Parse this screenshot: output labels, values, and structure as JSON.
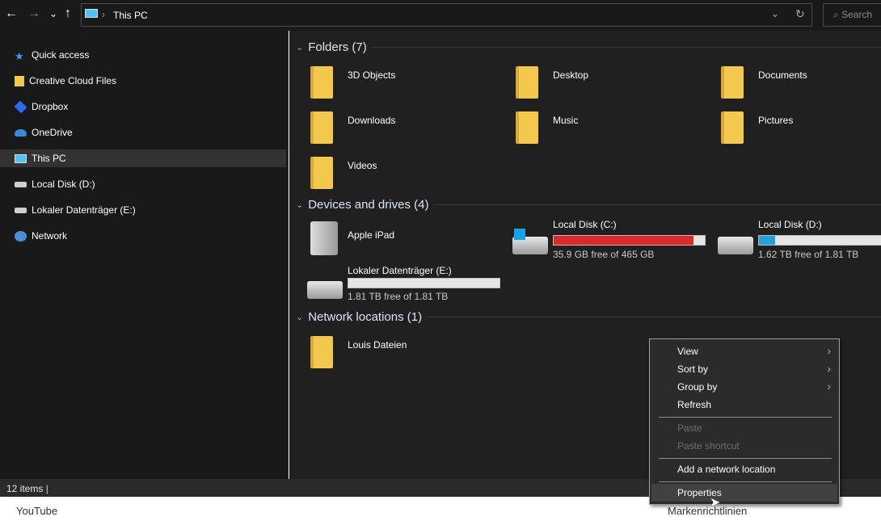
{
  "nav": {
    "back": "←",
    "forward": "→",
    "recent": "⌄",
    "up": "↑",
    "refresh": "↻",
    "dropdown": "⌄"
  },
  "address": {
    "path": "This PC",
    "separator": "›"
  },
  "search": {
    "placeholder": "Search"
  },
  "sidebar": {
    "items": [
      {
        "label": "Quick access",
        "icon": "star-icon",
        "color": "#3aa0ff"
      },
      {
        "label": "Creative Cloud Files",
        "icon": "creative-cloud-icon",
        "color": "#f2c94c"
      },
      {
        "label": "Dropbox",
        "icon": "dropbox-icon",
        "color": "#2a6bf2"
      },
      {
        "label": "OneDrive",
        "icon": "onedrive-icon",
        "color": "#2f8ee0"
      },
      {
        "label": "This PC",
        "icon": "computer-icon",
        "color": "#4fc3f7",
        "selected": true
      },
      {
        "label": "Local Disk (D:)",
        "icon": "drive-icon",
        "color": "#cfcfcf"
      },
      {
        "label": "Lokaler Datenträger (E:)",
        "icon": "drive-icon",
        "color": "#cfcfcf"
      },
      {
        "label": "Network",
        "icon": "network-icon",
        "color": "#4a90d9"
      }
    ]
  },
  "groups": {
    "folders": {
      "title": "Folders (7)",
      "items": [
        "3D Objects",
        "Desktop",
        "Documents",
        "Downloads",
        "Music",
        "Pictures",
        "Videos"
      ]
    },
    "devices": {
      "title": "Devices and drives (4)",
      "ipad": "Apple iPad",
      "drives": [
        {
          "name": "Local Disk (C:)",
          "free": "35.9 GB free of 465 GB",
          "used_pct": 92.3,
          "color": "#da2a2a"
        },
        {
          "name": "Local Disk (D:)",
          "free": "1.62 TB free of 1.81 TB",
          "used_pct": 10.5,
          "color": "#26a0da"
        },
        {
          "name": "Lokaler Datenträger (E:)",
          "free": "1.81 TB free of 1.81 TB",
          "used_pct": 0,
          "color": "#26a0da"
        }
      ]
    },
    "network": {
      "title": "Network locations (1)",
      "items": [
        "Louis Dateien"
      ]
    }
  },
  "menu": {
    "items": [
      "View",
      "Sort by",
      "Group by",
      "Refresh",
      "Paste",
      "Paste shortcut",
      "Add a network location",
      "Properties"
    ],
    "chevron": "›"
  },
  "status": {
    "count": "12 items"
  },
  "bottom": {
    "left": "YouTube",
    "right": "Markenrichtlinien"
  }
}
